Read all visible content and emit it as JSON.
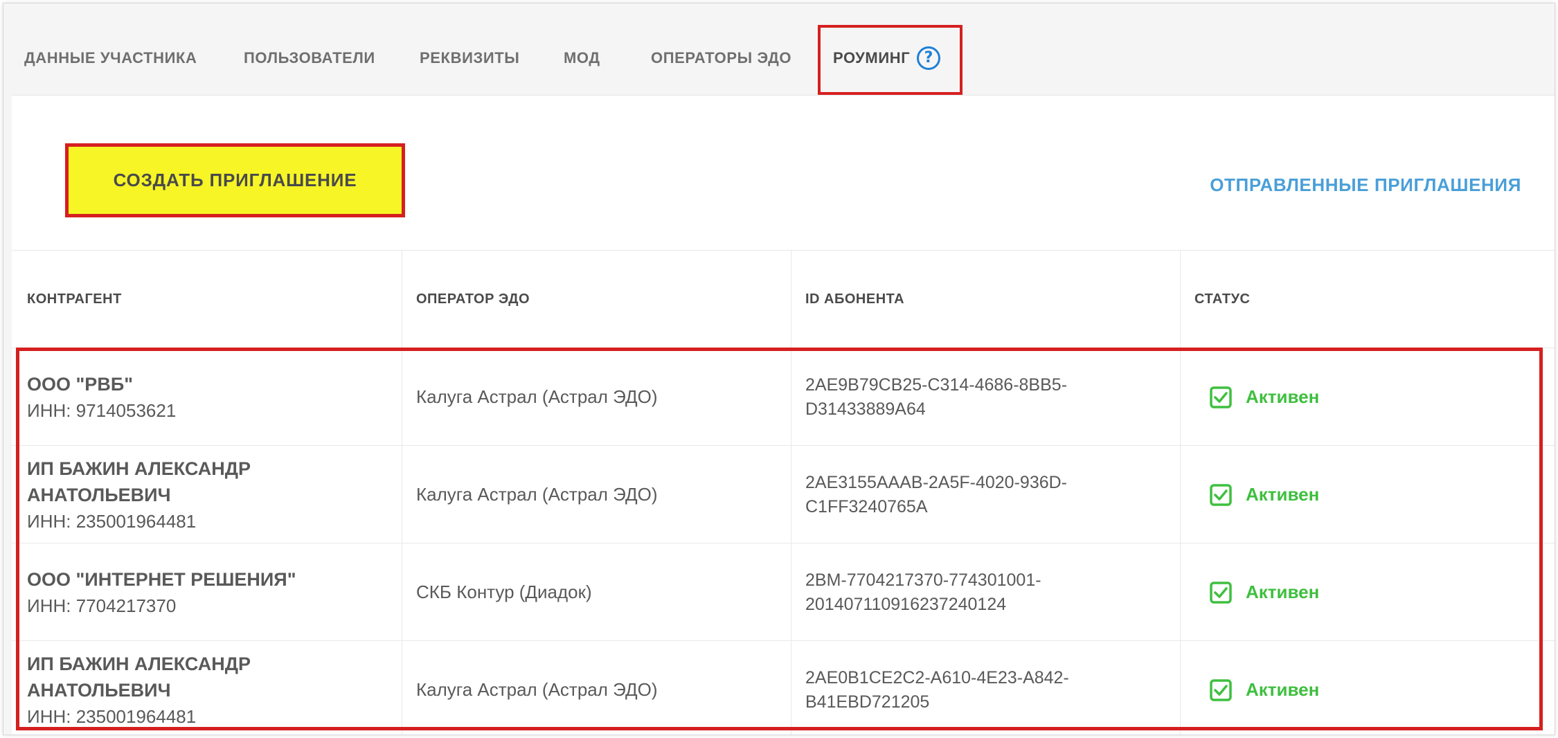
{
  "tabs": [
    {
      "label": "ДАННЫЕ УЧАСТНИКА"
    },
    {
      "label": "ПОЛЬЗОВАТЕЛИ"
    },
    {
      "label": "РЕКВИЗИТЫ"
    },
    {
      "label": "МОД"
    },
    {
      "label": "ОПЕРАТОРЫ ЭДО"
    },
    {
      "label": "РОУМИНГ",
      "active": true
    }
  ],
  "help_icon_glyph": "?",
  "create_button": {
    "label": "СОЗДАТЬ ПРИГЛАШЕНИЕ"
  },
  "sent_invites_link": {
    "label": "ОТПРАВЛЕННЫЕ ПРИГЛАШЕНИЯ"
  },
  "table": {
    "headers": [
      "КОНТРАГЕНТ",
      "ОПЕРАТОР ЭДО",
      "ID АБОНЕНТА",
      "СТАТУС"
    ],
    "rows": [
      {
        "name_lines": [
          "ООО \"РВБ\""
        ],
        "inn": "ИНН: 9714053621",
        "operator": "Калуга Астрал (Астрал ЭДО)",
        "id_lines": [
          "2AE9B79CB25-C314-4686-8BB5-",
          "D31433889A64"
        ],
        "status": "Активен"
      },
      {
        "name_lines": [
          "ИП БАЖИН АЛЕКСАНДР",
          "АНАТОЛЬЕВИЧ"
        ],
        "inn": "ИНН: 235001964481",
        "operator": "Калуга Астрал (Астрал ЭДО)",
        "id_lines": [
          "2AE3155AAAB-2A5F-4020-936D-",
          "C1FF3240765A"
        ],
        "status": "Активен"
      },
      {
        "name_lines": [
          "ООО \"ИНТЕРНЕТ РЕШЕНИЯ\""
        ],
        "inn": "ИНН: 7704217370",
        "operator": "СКБ Контур (Диадок)",
        "id_lines": [
          "2BM-7704217370-774301001-",
          "201407110916237240124"
        ],
        "status": "Активен"
      },
      {
        "name_lines": [
          "ИП БАЖИН АЛЕКСАНДР",
          "АНАТОЛЬЕВИЧ"
        ],
        "inn": "ИНН: 235001964481",
        "operator": "Калуга Астрал (Астрал ЭДО)",
        "id_lines": [
          "2AE0B1CE2C2-A610-4E23-A842-",
          "B41EBD721205"
        ],
        "status": "Активен"
      }
    ]
  },
  "colors": {
    "highlight": "#d61f1f",
    "button_bg": "#f7f526",
    "link": "#4a9fd8",
    "status_active": "#3fbf3f",
    "help_icon": "#1e7fd6"
  },
  "icons": {
    "status": "check-square-icon",
    "help": "question-circle-icon"
  }
}
